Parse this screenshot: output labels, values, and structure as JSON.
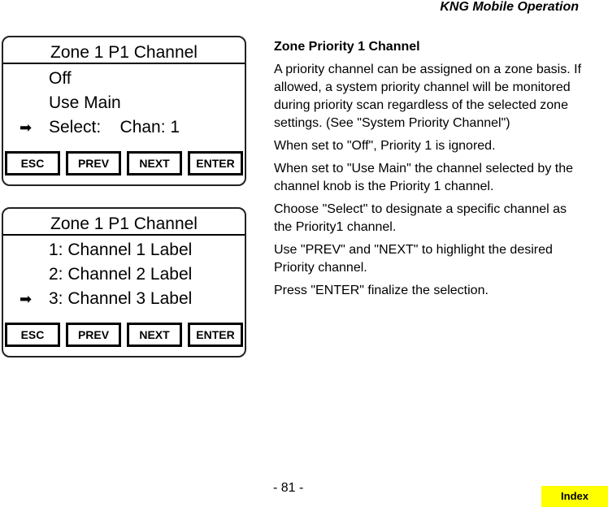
{
  "header": {
    "title": "KNG Mobile Operation"
  },
  "panels": [
    {
      "title": "Zone 1 P1 Channel",
      "rows": [
        {
          "arrow": "",
          "label": "Off"
        },
        {
          "arrow": "",
          "label": "Use Main"
        },
        {
          "arrow": "➡",
          "label": "Select:    Chan: 1"
        }
      ],
      "softkeys": [
        "ESC",
        "PREV",
        "NEXT",
        "ENTER"
      ]
    },
    {
      "title": "Zone 1 P1 Channel",
      "rows": [
        {
          "arrow": "",
          "label": "1: Channel 1 Label"
        },
        {
          "arrow": "",
          "label": "2: Channel 2 Label"
        },
        {
          "arrow": "➡",
          "label": "3: Channel 3 Label"
        }
      ],
      "softkeys": [
        "ESC",
        "PREV",
        "NEXT",
        "ENTER"
      ]
    }
  ],
  "description": {
    "heading": "Zone Priority 1 Channel",
    "paragraphs": [
      "A priority channel can be assigned  on a zone basis. If allowed, a system priority channel will be monitored during priority scan regardless of the selected zone settings. (See \"System Priority Channel\")",
      "When set to \"Off\", Priority 1 is ignored.",
      "When set to \"Use Main\" the channel selected by the channel knob is the Priority 1 channel.",
      "Choose \"Select\" to designate a specific channel as the Priority1 channel.",
      "Use \"PREV\" and \"NEXT\" to highlight the desired Priority channel.",
      "Press \"ENTER\" finalize the selection."
    ]
  },
  "footer": {
    "page_number": "- 81 -",
    "index_label": "Index",
    "index_color": "#ffff00"
  }
}
